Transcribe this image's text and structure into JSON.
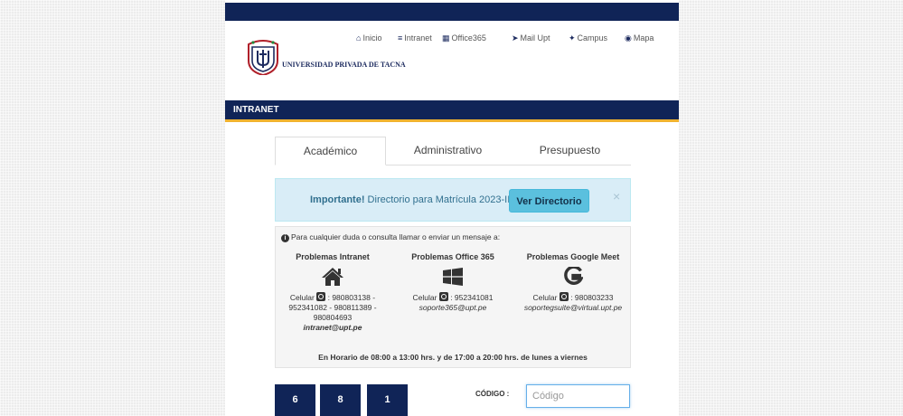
{
  "header": {
    "university_name": "UNIVERSIDAD PRIVADA DE TACNA",
    "nav": [
      {
        "label": "Inicio",
        "icon": "home-icon"
      },
      {
        "label": "Intranet",
        "icon": "server-icon"
      },
      {
        "label": "Office365",
        "icon": "office-icon"
      },
      {
        "label": "Mail Upt",
        "icon": "send-icon"
      },
      {
        "label": "Campus",
        "icon": "campus-icon"
      },
      {
        "label": "Mapa",
        "icon": "globe-icon"
      }
    ]
  },
  "section": {
    "title": "INTRANET"
  },
  "tabs": [
    {
      "label": "Académico",
      "active": true
    },
    {
      "label": "Administrativo",
      "active": false
    },
    {
      "label": "Presupuesto",
      "active": false
    }
  ],
  "alert": {
    "strong": "Importante!",
    "text": " Directorio para Matrícula 2023-II",
    "button": "Ver Directorio",
    "close": "×"
  },
  "contact": {
    "intro": "Para cualquier duda o consulta llamar o enviar un mensaje a:",
    "columns": [
      {
        "title": "Problemas Intranet",
        "icon": "home-icon",
        "phone_prefix": "Celular",
        "phone_lines": [
          ": 980803138 -",
          "952341082 - 980811389 -",
          "980804693"
        ],
        "email": "intranet@upt.pe"
      },
      {
        "title": "Problemas Office 365",
        "icon": "windows-icon",
        "phone_prefix": "Celular",
        "phone_lines": [
          ": 952341081"
        ],
        "email": "soporte365@upt.pe"
      },
      {
        "title": "Problemas Google Meet",
        "icon": "google-icon",
        "phone_prefix": "Celular",
        "phone_lines": [
          ": 980803233"
        ],
        "email": "soportegsuite@virtual.upt.pe"
      }
    ],
    "hours": "En Horario de 08:00 a 13:00 hrs. y de 17:00 a 20:00 hrs. de lunes a viernes"
  },
  "login": {
    "captcha": [
      "6",
      "8",
      "1"
    ],
    "code_label": "CÓDIGO :",
    "code_placeholder": "Código"
  },
  "colors": {
    "navy": "#102457",
    "gold": "#f0b22f",
    "alert_bg": "#d9edf7",
    "alert_button": "#5bc0de"
  }
}
